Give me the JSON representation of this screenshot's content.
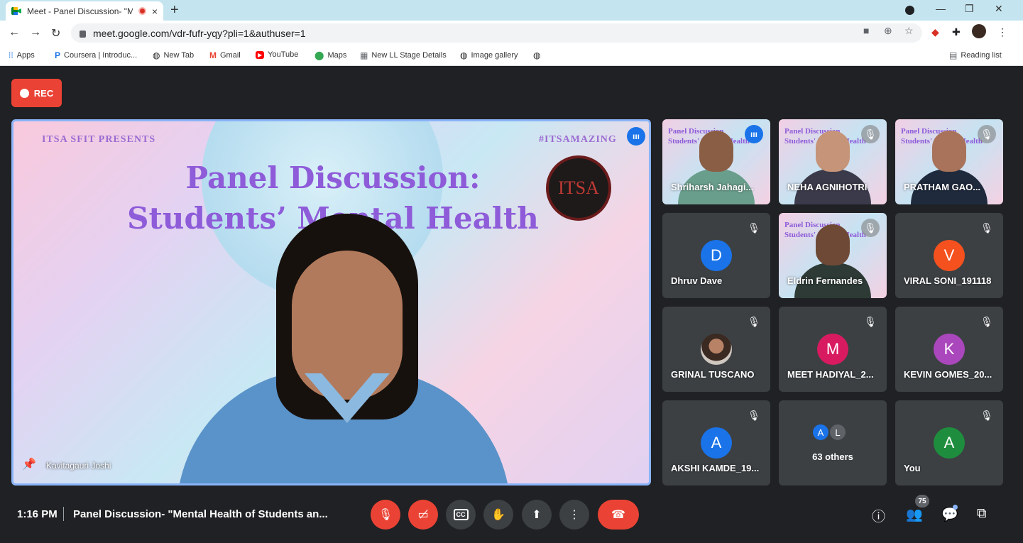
{
  "browser": {
    "tab_title": "Meet - Panel Discussion- \"M",
    "tab_close": "×",
    "new_tab": "+",
    "url": "meet.google.com/vdr-fufr-yqy?pli=1&authuser=1",
    "win_min": "—",
    "win_restore": "❐",
    "win_close": "✕",
    "bookmarks": [
      {
        "icon": "apps-icon",
        "glyph": "⋮⋮",
        "label": "Apps",
        "color": "#1a73e8"
      },
      {
        "icon": "coursera-icon",
        "glyph": "P",
        "label": "Coursera | Introduc...",
        "color": "#1a73e8"
      },
      {
        "icon": "globe-icon",
        "glyph": "●",
        "label": "New Tab",
        "color": "#202124"
      },
      {
        "icon": "gmail-icon",
        "glyph": "M",
        "label": "Gmail",
        "color": "#ea4335"
      },
      {
        "icon": "youtube-icon",
        "glyph": "▶",
        "label": "YouTube",
        "color": "#ff0000"
      },
      {
        "icon": "maps-icon",
        "glyph": "⬤",
        "label": "Maps",
        "color": "#34a853"
      },
      {
        "icon": "ll-stage-icon",
        "glyph": "▦",
        "label": "New LL Stage Details",
        "color": "#5f6368"
      },
      {
        "icon": "globe-icon",
        "glyph": "●",
        "label": "Image gallery",
        "color": "#202124"
      },
      {
        "icon": "globe-icon",
        "glyph": "●",
        "label": "",
        "color": "#202124"
      }
    ],
    "reading_list": "Reading list"
  },
  "meet": {
    "rec_label": "REC",
    "main_tile": {
      "banner_left": "ITSA SFIT PRESENTS",
      "banner_right": "#ITSAMAZING",
      "heading_line1": "Panel Discussion:",
      "heading_line2": "Students’ Mental Health",
      "logo_text": "ITSA",
      "speaker_name": "Kavitagauri Joshi"
    },
    "tiles": [
      {
        "name": "Shriharsh Jahagi...",
        "type": "video",
        "shirt": "#6a9e8c",
        "status": "speaking"
      },
      {
        "name": "NEHA AGNIHOTRI",
        "type": "video",
        "shirt": "#3a3a4a",
        "status": "muted"
      },
      {
        "name": "PRATHAM GAO...",
        "type": "video",
        "shirt": "#1f2a3d",
        "status": "muted"
      },
      {
        "name": "Dhruv Dave",
        "type": "avatar",
        "initial": "D",
        "color": "#1a73e8",
        "status": "muted"
      },
      {
        "name": "Eldrin Fernandes",
        "type": "video",
        "shirt": "#2d3a35",
        "status": "muted"
      },
      {
        "name": "VIRAL SONI_191118",
        "type": "avatar",
        "initial": "V",
        "color": "#f4511e",
        "status": "muted"
      },
      {
        "name": "GRINAL TUSCANO",
        "type": "photo",
        "status": "muted"
      },
      {
        "name": "MEET HADIYAL_2...",
        "type": "avatar",
        "initial": "M",
        "color": "#d81b60",
        "status": "muted"
      },
      {
        "name": "KEVIN GOMES_20...",
        "type": "avatar",
        "initial": "K",
        "color": "#ab47bc",
        "status": "muted"
      },
      {
        "name": "AKSHI KAMDE_19...",
        "type": "avatar",
        "initial": "A",
        "color": "#1a73e8",
        "status": "muted"
      },
      {
        "name": "63 others",
        "type": "others",
        "initials": [
          "A",
          "L"
        ],
        "colors": [
          "#1a73e8",
          "#5f6368"
        ]
      },
      {
        "name": "You",
        "type": "avatar",
        "initial": "A",
        "color": "#1e8e3e",
        "status": "muted"
      }
    ],
    "time": "1:16 PM",
    "meeting_title": "Panel Discussion- \"Mental Health of Students an...",
    "participants_count": "75",
    "cc_label": "CC"
  }
}
